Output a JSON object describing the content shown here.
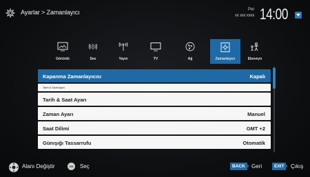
{
  "header": {
    "breadcrumb": "Ayarlar > Zamanlayıcı",
    "day": "Per",
    "date": "xx xxx xxxx",
    "time": "14:00"
  },
  "tabs": [
    {
      "label": "Görüntü",
      "icon": "picture-icon",
      "active": false
    },
    {
      "label": "Ses",
      "icon": "sound-icon",
      "active": false
    },
    {
      "label": "Yayın",
      "icon": "broadcast-icon",
      "active": false
    },
    {
      "label": "TV",
      "icon": "tv-icon",
      "active": false
    },
    {
      "label": "Ağ",
      "icon": "network-icon",
      "active": false
    },
    {
      "label": "Zamanlayıcı",
      "icon": "timer-gear-icon",
      "active": true
    },
    {
      "label": "Ebeveyn",
      "icon": "parental-icon",
      "active": false
    }
  ],
  "rows": [
    {
      "key": "Kapanma Zamanlayıcısı",
      "value": "Kapalı",
      "selected": true
    },
    {
      "key": "Tarih & Saat Ayarı",
      "value": "",
      "small": true
    },
    {
      "key": "Tarih & Saat Ayarı",
      "value": ""
    },
    {
      "key": "Zaman Ayarı",
      "value": "Manuel"
    },
    {
      "key": "Saat Dilimi",
      "value": "GMT +2"
    },
    {
      "key": "Günışığı Tassarrufu",
      "value": "Otomatik"
    }
  ],
  "footer": {
    "navigate_label": "Alanı Değiştir",
    "ok_badge": "OK",
    "select_label": "Seç",
    "back_key": "BACK",
    "back_label": "Geri",
    "exit_key": "EXIT",
    "exit_label": "Çıkış"
  },
  "colors": {
    "accent": "#1f6aa6",
    "row_bg": "#f6f6f6",
    "background": "#0d0e10"
  }
}
